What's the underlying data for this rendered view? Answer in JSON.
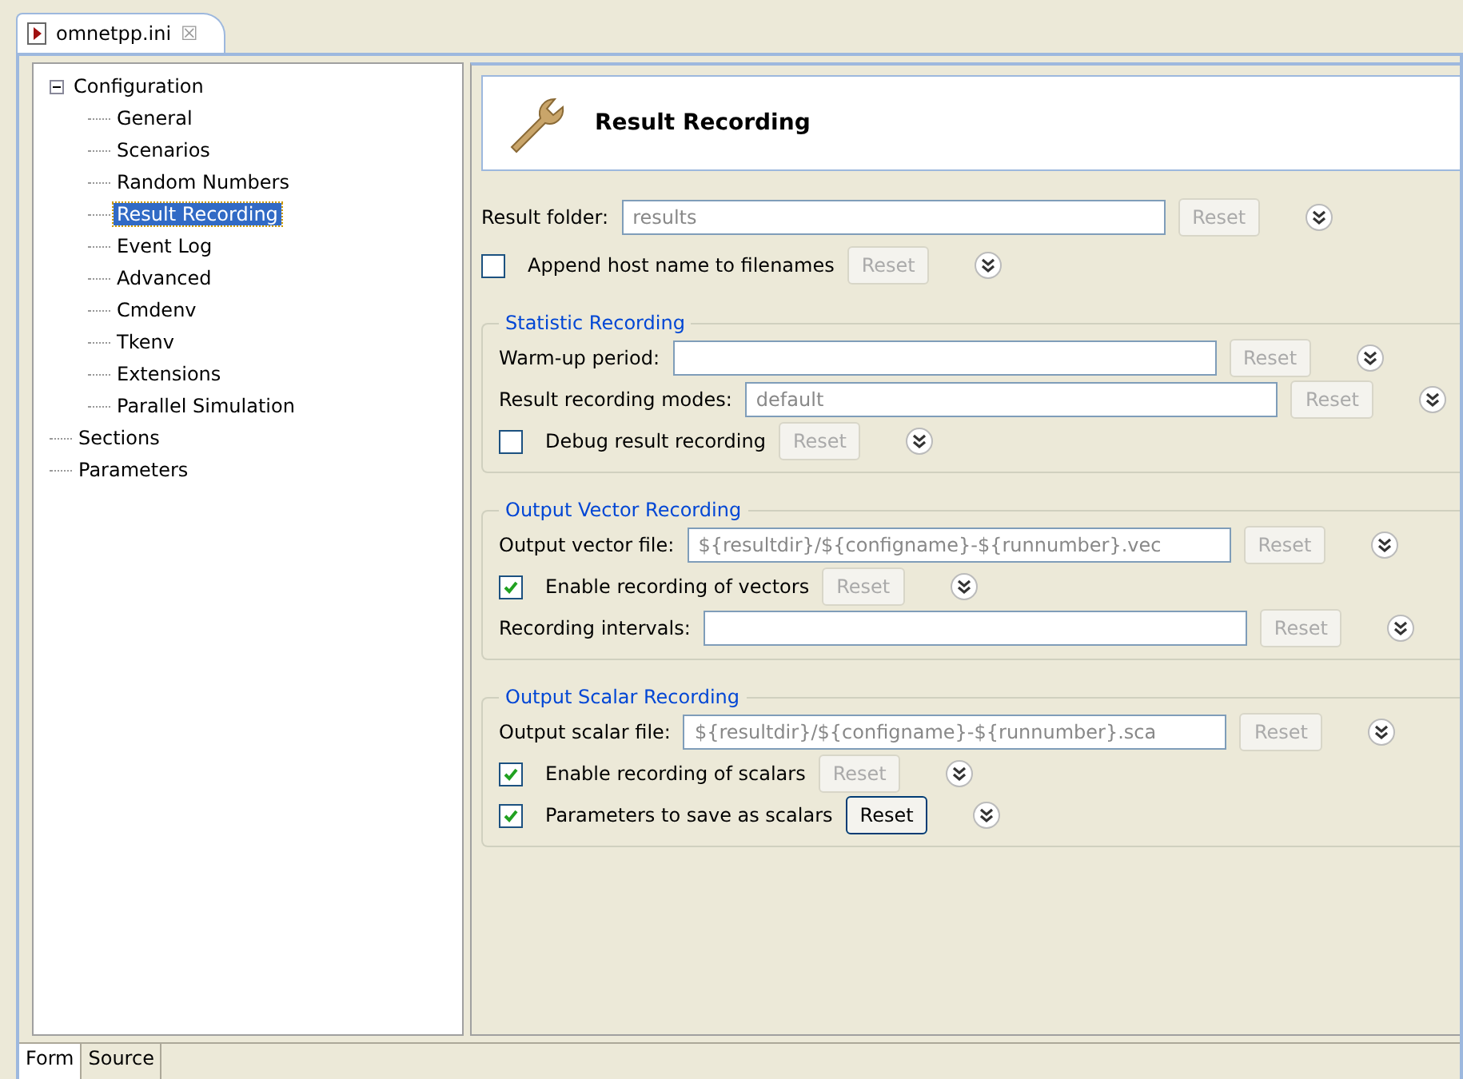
{
  "editor_tab": {
    "title": "omnetpp.ini",
    "close": "☒"
  },
  "tree": [
    {
      "label": "Configuration",
      "expanded": true,
      "selected": false,
      "children": [
        {
          "label": "General",
          "selected": false
        },
        {
          "label": "Scenarios",
          "selected": false
        },
        {
          "label": "Random Numbers",
          "selected": false
        },
        {
          "label": "Result Recording",
          "selected": true
        },
        {
          "label": "Event Log",
          "selected": false
        },
        {
          "label": "Advanced",
          "selected": false
        },
        {
          "label": "Cmdenv",
          "selected": false
        },
        {
          "label": "Tkenv",
          "selected": false
        },
        {
          "label": "Extensions",
          "selected": false
        },
        {
          "label": "Parallel Simulation",
          "selected": false
        }
      ]
    },
    {
      "label": "Sections",
      "selected": false
    },
    {
      "label": "Parameters",
      "selected": false
    }
  ],
  "page_title": "Result Recording",
  "fields": [
    {
      "kind": "text",
      "label": "Result folder:",
      "placeholder": "results",
      "reset": "Reset",
      "reset_enabled": false
    },
    {
      "kind": "checkbox",
      "label": "Append host name to filenames",
      "checked": false,
      "reset": "Reset",
      "reset_enabled": false
    }
  ],
  "groups": [
    {
      "title": "Statistic Recording",
      "fields": [
        {
          "kind": "text",
          "label": "Warm-up period:",
          "reset": "Reset",
          "reset_enabled": false
        },
        {
          "kind": "text",
          "label": "Result recording modes:",
          "placeholder": "default",
          "reset": "Reset",
          "reset_enabled": false
        },
        {
          "kind": "checkbox",
          "label": "Debug result recording",
          "checked": false,
          "reset": "Reset",
          "reset_enabled": false
        }
      ]
    },
    {
      "title": "Output Vector Recording",
      "fields": [
        {
          "kind": "text",
          "label": "Output vector file:",
          "placeholder": "${resultdir}/${configname}-${runnumber}.vec",
          "reset": "Reset",
          "reset_enabled": false
        },
        {
          "kind": "checkbox",
          "label": "Enable recording of vectors",
          "checked": true,
          "reset": "Reset",
          "reset_enabled": false
        },
        {
          "kind": "text",
          "label": "Recording intervals:",
          "reset": "Reset",
          "reset_enabled": false
        }
      ]
    },
    {
      "title": "Output Scalar Recording",
      "fields": [
        {
          "kind": "text",
          "label": "Output scalar file:",
          "placeholder": "${resultdir}/${configname}-${runnumber}.sca",
          "reset": "Reset",
          "reset_enabled": false
        },
        {
          "kind": "checkbox",
          "label": "Enable recording of scalars",
          "checked": true,
          "reset": "Reset",
          "reset_enabled": false
        },
        {
          "kind": "checkbox",
          "label": "Parameters to save as scalars",
          "checked": true,
          "reset": "Reset",
          "reset_enabled": true
        }
      ]
    }
  ],
  "bottom_tabs": [
    {
      "label": "Form",
      "selected": true
    },
    {
      "label": "Source",
      "selected": false
    }
  ]
}
